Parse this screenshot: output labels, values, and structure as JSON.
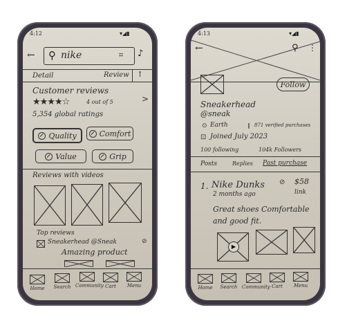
{
  "phone1": {
    "status_time": "4:12",
    "search": {
      "query": "nike"
    },
    "tabs": {
      "left": "Detail",
      "right": "Review"
    },
    "reviews": {
      "title": "Customer reviews",
      "rating": "4 out of 5",
      "ratings_count": "5,354 global ratings",
      "chevron": ">"
    },
    "chips": [
      "Quality",
      "Comfort",
      "Value",
      "Grip"
    ],
    "videos_title": "Reviews with videos",
    "top_reviews": "Top reviews",
    "reviewer": "Sneakerhead @Sneak",
    "review_text": "Amazing product"
  },
  "phone2": {
    "status_time": "4:13",
    "follow_label": "Follow",
    "profile": {
      "name": "Sneakerhead",
      "handle": "@sneak",
      "location": "Earth",
      "purchases": "871 verified purchases",
      "joined": "Joined July 2023",
      "following": "100 following",
      "followers": "104k Followers"
    },
    "tabs": [
      "Posts",
      "Replies",
      "Past purchase"
    ],
    "post": {
      "index": "1.",
      "title": "Nike Dunks",
      "price": "$58",
      "time": "2 months ago",
      "link": "link",
      "text_line1": "Great shoes Comfortable",
      "text_line2": "and good fit."
    }
  },
  "nav": [
    "Home",
    "Search",
    "Community",
    "Cart",
    "Menu"
  ]
}
